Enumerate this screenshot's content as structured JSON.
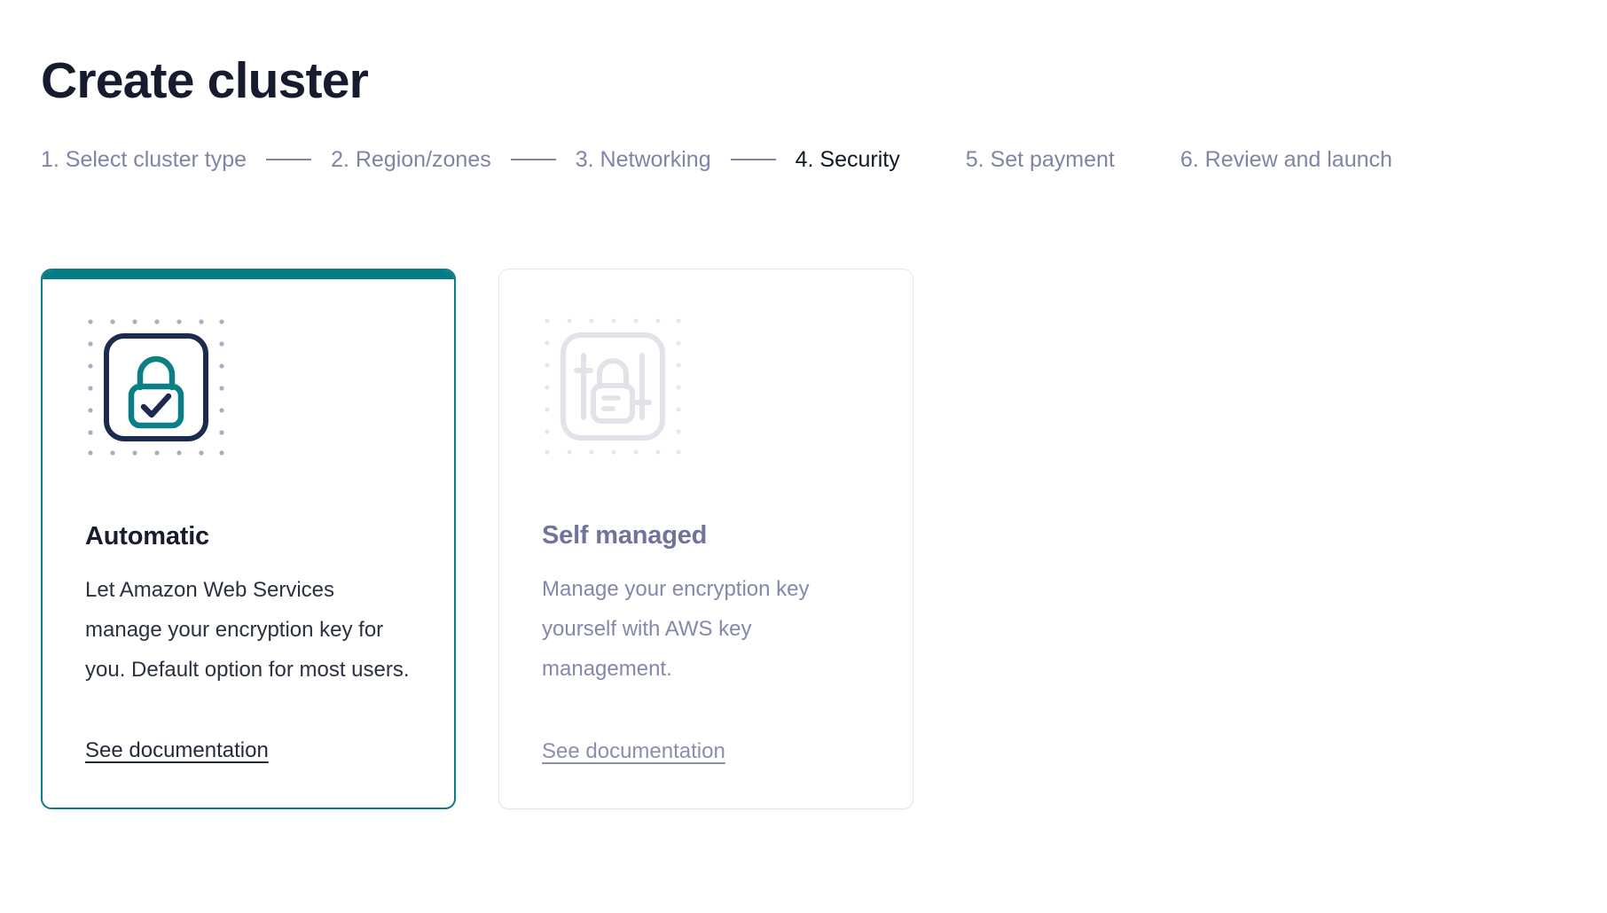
{
  "header": {
    "title": "Create cluster"
  },
  "stepper": {
    "steps": [
      {
        "label": "1. Select cluster type",
        "active": false,
        "connector_after": true
      },
      {
        "label": "2. Region/zones",
        "active": false,
        "connector_after": true
      },
      {
        "label": "3. Networking",
        "active": false,
        "connector_after": true
      },
      {
        "label": "4. Security",
        "active": true,
        "connector_after": false
      },
      {
        "label": "5. Set payment",
        "active": false,
        "connector_after": false
      },
      {
        "label": "6. Review and launch",
        "active": false,
        "connector_after": false
      }
    ]
  },
  "cards": [
    {
      "id": "automatic",
      "heading": "Automatic",
      "description": "Let Amazon Web Services manage your encryption key for you. Default option for most users.",
      "link_label": "See documentation",
      "icon": "lock-check-icon",
      "state": "selected"
    },
    {
      "id": "self-managed",
      "heading": "Self managed",
      "description": "Manage your encryption key yourself with AWS key management.",
      "link_label": "See documentation",
      "icon": "lock-sliders-icon",
      "state": "disabled"
    }
  ],
  "colors": {
    "accent_teal": "#047c84",
    "selected_border": "#0e7c86",
    "icon_outline_navy": "#1b2a4e",
    "lock_teal": "#0b7f86",
    "muted_text": "#8084a6",
    "active_step_text": "#111827",
    "title_text": "#161b2e",
    "body_text": "#2c3142",
    "disabled_heading": "#72739a",
    "disabled_body": "#8588ac",
    "muted_icon": "#e2e3e9",
    "dot_grid": "#a9aec4",
    "dot_grid_muted": "#e6e7ed",
    "card_border_muted": "#e6e7ec"
  }
}
